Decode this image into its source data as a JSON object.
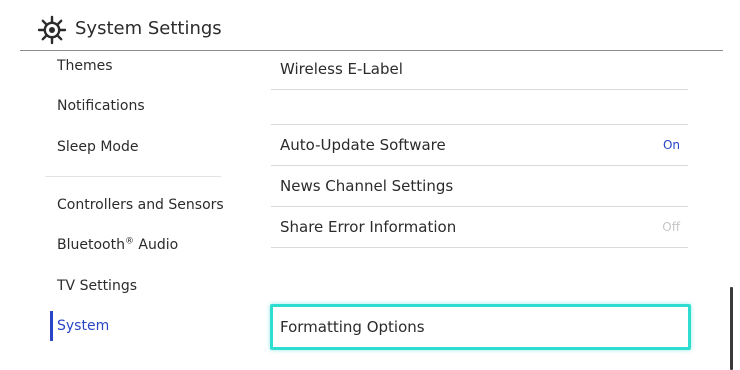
{
  "header": {
    "title": "System Settings",
    "icon": "gear-icon"
  },
  "sidebar": {
    "items": [
      {
        "label": "Themes"
      },
      {
        "label": "Notifications"
      },
      {
        "label": "Sleep Mode"
      },
      {
        "label": "Controllers and Sensors"
      },
      {
        "label": "Bluetooth",
        "superscript": "®",
        "label_suffix": " Audio"
      },
      {
        "label": "TV Settings"
      },
      {
        "label": "System",
        "active": true
      }
    ]
  },
  "main": {
    "rows": [
      {
        "label": "Wireless E-Label",
        "value": ""
      },
      {
        "label": "Auto-Update Software",
        "value": "On"
      },
      {
        "label": "News Channel Settings",
        "value": ""
      },
      {
        "label": "Share Error Information",
        "value": "Off"
      },
      {
        "label": "Formatting Options",
        "value": "",
        "selected": true
      }
    ]
  },
  "colors": {
    "accent": "#2a45c6",
    "selection_outline": "#2fdcd0",
    "off_value": "#c6c6c6"
  }
}
